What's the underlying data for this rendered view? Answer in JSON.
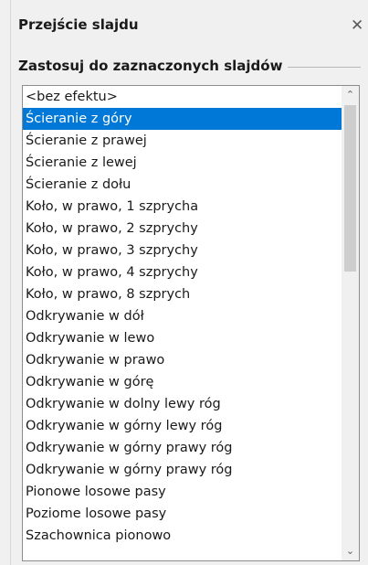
{
  "panel": {
    "title": "Przejście slajdu",
    "close_icon": "close-icon"
  },
  "section": {
    "label": "Zastosuj do zaznaczonych slajdów"
  },
  "transitions": {
    "selected_index": 1,
    "items": [
      "<bez efektu>",
      "Ścieranie z góry",
      "Ścieranie z prawej",
      "Ścieranie z lewej",
      "Ścieranie z dołu",
      "Koło, w prawo, 1 szprycha",
      "Koło, w prawo, 2 szprychy",
      "Koło, w prawo, 3 szprychy",
      "Koło, w prawo, 4 szprychy",
      "Koło, w prawo, 8 szprych",
      "Odkrywanie w dół",
      "Odkrywanie w lewo",
      "Odkrywanie w prawo",
      "Odkrywanie w górę",
      "Odkrywanie w dolny lewy róg",
      "Odkrywanie w górny lewy róg",
      "Odkrywanie w górny prawy róg",
      "Odkrywanie w górny prawy róg",
      "Pionowe losowe pasy",
      "Poziome losowe pasy",
      "Szachownica pionowo"
    ]
  },
  "colors": {
    "selection": "#0078d7",
    "panel_bg": "#f0f0f0"
  },
  "scrollbar": {
    "up_icon": "chevron-up-icon",
    "down_icon": "chevron-down-icon"
  }
}
